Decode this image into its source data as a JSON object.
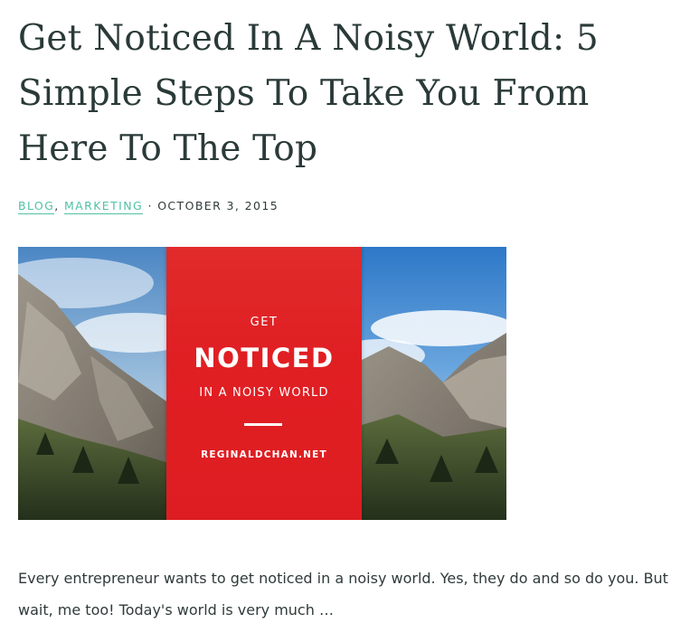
{
  "post": {
    "title": "Get Noticed In A Noisy World: 5 Simple Steps To Take You From Here To The Top",
    "categories": [
      "BLOG",
      "MARKETING"
    ],
    "category_separator": ",",
    "meta_separator": "·",
    "date": "OCTOBER 3, 2015",
    "featured_image": {
      "overlay_line1": "GET",
      "overlay_line2": "NOTICED",
      "overlay_line3": "IN A NOISY WORLD",
      "overlay_site": "REGINALDCHAN.NET",
      "panel_color": "#e01f23"
    },
    "excerpt": "Every entrepreneur wants to get noticed in a noisy world. Yes, they do and so do you. But wait, me too! Today's world is very much …"
  },
  "colors": {
    "title": "#2a3a38",
    "link_accent": "#4fc2a4",
    "body_text": "#2f3b3a"
  }
}
